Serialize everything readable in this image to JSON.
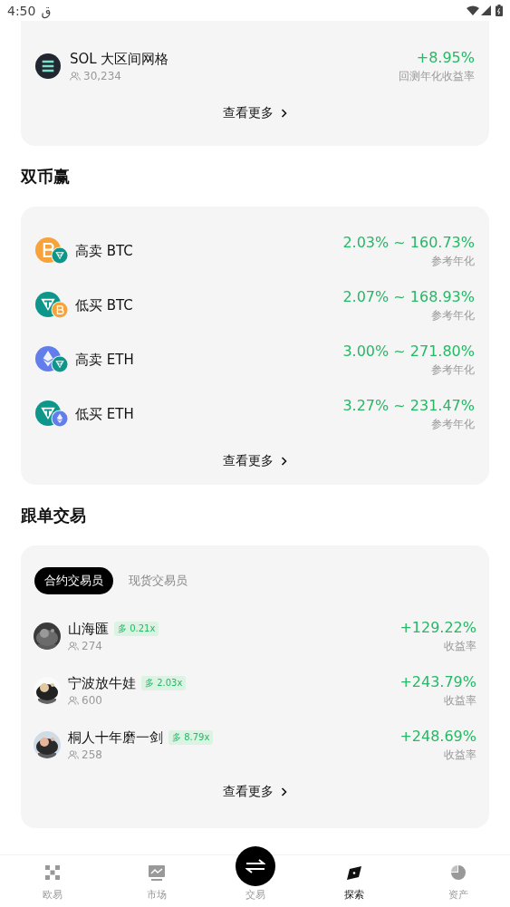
{
  "status_bar": {
    "time": "4:50",
    "carrier": "ق"
  },
  "grid_card": {
    "items": [
      {
        "kind": "sol",
        "name": "SOL 大区间网格",
        "followers": "30,234",
        "return": "+8.95%",
        "return_label": "回测年化收益率"
      }
    ],
    "more": "查看更多"
  },
  "dual_currency": {
    "title": "双币赢",
    "items": [
      {
        "kind": "btc-usdt",
        "name": "高卖 BTC",
        "range": "2.03% ~ 160.73%",
        "range_label": "参考年化"
      },
      {
        "kind": "usdt-btc",
        "name": "低买 BTC",
        "range": "2.07% ~ 168.93%",
        "range_label": "参考年化"
      },
      {
        "kind": "eth-usdt",
        "name": "高卖 ETH",
        "range": "3.00% ~ 271.80%",
        "range_label": "参考年化"
      },
      {
        "kind": "usdt-eth",
        "name": "低买 ETH",
        "range": "3.27% ~ 231.47%",
        "range_label": "参考年化"
      }
    ],
    "more": "查看更多"
  },
  "copy_trading": {
    "title": "跟单交易",
    "tabs": [
      {
        "label": "合约交易员",
        "selected": true
      },
      {
        "label": "现货交易员",
        "selected": false
      }
    ],
    "traders": [
      {
        "name": "山海匯",
        "tag": "多 0.21x",
        "followers": "274",
        "return": "+129.22%",
        "return_label": "收益率"
      },
      {
        "name": "宁波放牛娃",
        "tag": "多 2.03x",
        "followers": "600",
        "return": "+243.79%",
        "return_label": "收益率"
      },
      {
        "name": "桐人十年磨一剑",
        "tag": "多 8.79x",
        "followers": "258",
        "return": "+248.69%",
        "return_label": "收益率"
      }
    ],
    "more": "查看更多"
  },
  "bottom_nav": {
    "items": [
      {
        "kind": "tab",
        "label": "欧易",
        "selected": false
      },
      {
        "kind": "tab",
        "label": "市场",
        "selected": false
      },
      {
        "kind": "center",
        "label": "交易",
        "selected": false
      },
      {
        "kind": "tab",
        "label": "探索",
        "selected": true
      },
      {
        "kind": "tab",
        "label": "资产",
        "selected": false
      }
    ]
  }
}
